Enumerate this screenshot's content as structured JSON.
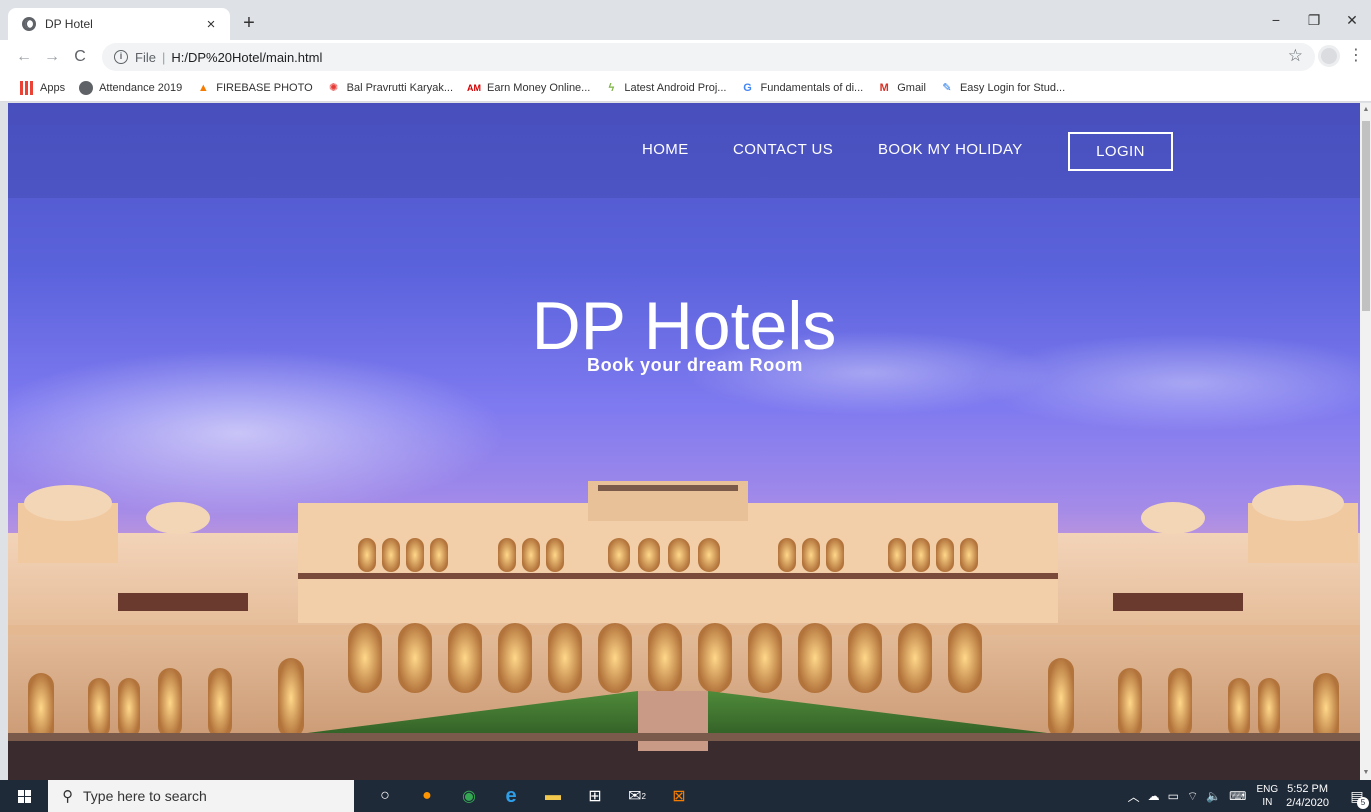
{
  "browser": {
    "tab_title": "DP Hotel",
    "tab_close": "×",
    "new_tab": "+",
    "window_controls": {
      "minimize": "−",
      "maximize": "❐",
      "close": "✕"
    },
    "nav": {
      "back": "←",
      "forward": "→",
      "reload": "C"
    },
    "address": {
      "scheme": "File",
      "separator": "|",
      "url": "H:/DP%20Hotel/main.html"
    },
    "bookmarks": [
      {
        "label": "Apps",
        "icon": "apps-grid-icon"
      },
      {
        "label": "Attendance 2019",
        "icon": "globe-icon"
      },
      {
        "label": "FIREBASE PHOTO",
        "icon": "firebase-icon"
      },
      {
        "label": "Bal Pravrutti Karyak...",
        "icon": "bal-icon"
      },
      {
        "label": "Earn Money Online...",
        "icon": "am-icon"
      },
      {
        "label": "Latest Android Proj...",
        "icon": "android-icon"
      },
      {
        "label": "Fundamentals of di...",
        "icon": "google-icon"
      },
      {
        "label": "Gmail",
        "icon": "gmail-icon"
      },
      {
        "label": "Easy Login for Stud...",
        "icon": "easy-login-icon"
      }
    ]
  },
  "site": {
    "nav": {
      "home": "HOME",
      "contact": "CONTACT US",
      "book": "BOOK MY HOLIDAY",
      "login": "LOGIN"
    },
    "hero": {
      "title": "DP Hotels",
      "subtitle": "Book your dream Room"
    }
  },
  "taskbar": {
    "search_placeholder": "Type here to search",
    "language": {
      "top": "ENG",
      "bottom": "IN"
    },
    "time": "5:52 PM",
    "date": "2/4/2020",
    "notification_count": "5",
    "mail_badge": "2"
  },
  "colors": {
    "sky_top": "#4f55c8",
    "sky_mid": "#7f7af0",
    "horizon": "#f0b8a8",
    "taskbar": "#1f2a38"
  }
}
